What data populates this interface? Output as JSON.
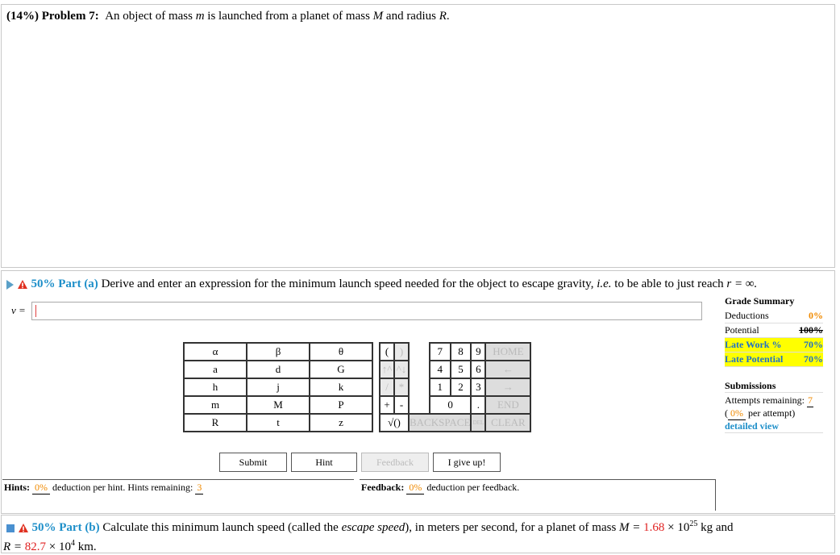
{
  "problem": {
    "weight": "(14%)",
    "label": "Problem 7:",
    "statement_pre": "An object of mass",
    "m": "m",
    "statement_mid1": "is launched from a planet of mass",
    "M": "M",
    "statement_mid2": "and radius",
    "R": "R",
    "end": "."
  },
  "part_a": {
    "percent": "50%",
    "label": "Part (a)",
    "text_pre": "Derive and enter an expression for the minimum launch speed needed for the object to escape gravity,",
    "ie": "i.e.",
    "text_post": "to be able to just reach",
    "r_expr": "r = ∞.",
    "variable": "v ="
  },
  "keypad": {
    "letters": [
      [
        "α",
        "β",
        "θ"
      ],
      [
        "a",
        "d",
        "G"
      ],
      [
        "h",
        "j",
        "k"
      ],
      [
        "m",
        "M",
        "P"
      ],
      [
        "R",
        "t",
        "z"
      ]
    ],
    "ops": [
      "(",
      ")",
      "↑^",
      "^↓",
      "/",
      "*",
      "+",
      "-",
      "√()"
    ],
    "digits": [
      [
        "7",
        "8",
        "9"
      ],
      [
        "4",
        "5",
        "6"
      ],
      [
        "1",
        "2",
        "3"
      ],
      [
        "0",
        "."
      ]
    ],
    "nav": [
      "HOME",
      "←",
      "→",
      "END"
    ],
    "backspace": "BACKSPACE",
    "del": "DEL",
    "clear": "CLEAR"
  },
  "buttons": {
    "submit": "Submit",
    "hint": "Hint",
    "feedback": "Feedback",
    "give_up": "I give up!"
  },
  "grade": {
    "title": "Grade Summary",
    "deductions_label": "Deductions",
    "deductions_value": "0%",
    "potential_label": "Potential",
    "potential_value": "100%",
    "late_work_label": "Late Work %",
    "late_work_value": "70%",
    "late_potential_label": "Late Potential",
    "late_potential_value": "70%",
    "submissions_title": "Submissions",
    "attempts_label": "Attempts remaining:",
    "attempts_value": "7",
    "per_attempt_value": "0%",
    "per_attempt_label": "per attempt)",
    "detailed_view": "detailed view"
  },
  "hints": {
    "label": "Hints:",
    "value": "0%",
    "text": "deduction per hint. Hints remaining:",
    "remaining": "3"
  },
  "feedback": {
    "label": "Feedback:",
    "value": "0%",
    "text": "deduction per feedback."
  },
  "part_b": {
    "percent": "50%",
    "label": "Part (b)",
    "text_pre": "Calculate this minimum launch speed (called the",
    "escape": "escape speed",
    "text_mid": "), in meters per second, for a planet of mass",
    "M_eq": "M =",
    "mass_val": "1.68",
    "times": "×",
    "mass_exp_base": "10",
    "mass_exp": "25",
    "mass_unit": "kg and",
    "R_eq": "R =",
    "radius_val": "82.7",
    "radius_exp_base": "10",
    "radius_exp": "4",
    "radius_unit": "km."
  },
  "colors": {
    "accent": "#1e8fc9",
    "orange": "#f08a00",
    "red": "#e02020",
    "highlight": "#ffff00"
  }
}
